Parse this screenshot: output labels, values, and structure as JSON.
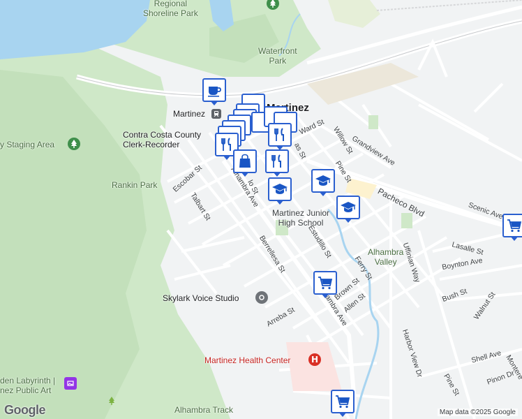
{
  "map": {
    "attribution": "Map data ©2025 Google",
    "logo": "Google",
    "colors": {
      "water": "#a8d4f0",
      "park": "#cde9c7",
      "land": "#f1f3f4",
      "road": "#ffffff",
      "marker_border": "#2a5fcf",
      "health": "#d93025"
    }
  },
  "places": {
    "shoreline_park": "Regional\nShoreline Park",
    "waterfront_park": "Waterfront\nPark",
    "martinez": "Martinez",
    "martinez_station": "Martinez",
    "clerk": "Contra Costa County\nClerk-Recorder",
    "staging": "y Staging Area",
    "rankin": "Rankin Park",
    "junior_high": "Martinez Junior\nHigh School",
    "alhambra_valley": "Alhambra\nValley",
    "skylark": "Skylark Voice Studio",
    "health_center": "Martinez Health Center",
    "labyrinth": "den Labyrinth |\nnez Public Art",
    "track": "Alhambra Track"
  },
  "streets": {
    "escobar": "Escobar St",
    "talbart": "Talbart St",
    "alhambra1": "Alhambra Ave",
    "berrellesa": "Berrellesa St",
    "alhambra2": "Alhambra Ave",
    "arreba": "Arreba St",
    "estudillo": "Estudillo St",
    "ferry": "Ferry St",
    "brown": "Brown St",
    "allen": "Allen St",
    "ward": "Ward St",
    "willow": "Willow St",
    "grandview": "Grandview Ave",
    "pine1": "Pine St",
    "pacheco": "Pacheco Blvd",
    "scenic": "Scenic Ave",
    "lasalle": "Lasalle St",
    "boynton": "Boynton Ave",
    "uffinian": "Uffinian Way",
    "bush": "Bush St",
    "walnut": "Walnut St",
    "harbor": "Harbor View Dr",
    "shell": "Shell Ave",
    "pine2": "Pine St",
    "pinon": "Pinon Dr",
    "montere": "Montere",
    "las": "as St",
    "lo": "lo St"
  },
  "markers": [
    {
      "name": "coffee-marker",
      "icon": "coffee-icon"
    },
    {
      "name": "restaurant-marker-1",
      "icon": "fork-knife-icon"
    },
    {
      "name": "restaurant-marker-2",
      "icon": "fork-knife-icon"
    },
    {
      "name": "restaurant-marker-3",
      "icon": "fork-knife-icon"
    },
    {
      "name": "shopping-marker",
      "icon": "shopping-bag-icon"
    },
    {
      "name": "school-marker-1",
      "icon": "school-icon"
    },
    {
      "name": "school-marker-2",
      "icon": "school-icon"
    },
    {
      "name": "school-marker-3",
      "icon": "school-icon"
    },
    {
      "name": "grocery-marker-1",
      "icon": "shopping-cart-icon"
    },
    {
      "name": "grocery-marker-2",
      "icon": "shopping-cart-icon"
    },
    {
      "name": "grocery-marker-3",
      "icon": "shopping-cart-icon"
    }
  ]
}
